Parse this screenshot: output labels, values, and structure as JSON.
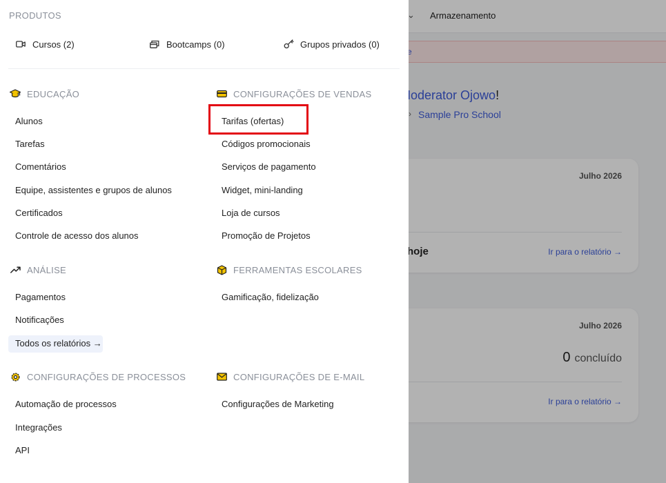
{
  "background": {
    "topbar_chevron": "⌄",
    "storage_label": "Armazenamento",
    "banner_fragment": "e",
    "greeting": "Moderator Ojowo",
    "greeting_suffix": "!",
    "breadcrumb_sep": "›",
    "school_name": "Sample Pro School",
    "card1": {
      "date": "Julho 2026",
      "today_fragment": "hoje",
      "report_link": "Ir para o relatório →"
    },
    "card2": {
      "date": "Julho 2026",
      "count": "0",
      "count_label": "concluído",
      "report_link": "Ir para o relatório →"
    }
  },
  "menu": {
    "products": {
      "title": "PRODUTOS",
      "items": [
        {
          "label": "Cursos (2)",
          "icon": "video-icon"
        },
        {
          "label": "Bootcamps (0)",
          "icon": "bootcamp-icon"
        },
        {
          "label": "Grupos privados (0)",
          "icon": "key-icon"
        }
      ]
    },
    "education": {
      "title": "EDUCAÇÃO",
      "icon": "graduation-cap-icon",
      "items": [
        "Alunos",
        "Tarefas",
        "Comentários",
        "Equipe, assistentes e grupos de alunos",
        "Certificados",
        "Controle de acesso dos alunos"
      ]
    },
    "sales": {
      "title": "CONFIGURAÇÕES DE VENDAS",
      "icon": "credit-card-icon",
      "items": [
        "Tarifas (ofertas)",
        "Códigos promocionais",
        "Serviços de pagamento",
        "Widget, mini-landing",
        "Loja de cursos",
        "Promoção de Projetos"
      ]
    },
    "analysis": {
      "title": "ANÁLISE",
      "icon": "trend-up-icon",
      "items": [
        "Pagamentos",
        "Notificações",
        "Todos os relatórios →"
      ]
    },
    "school_tools": {
      "title": "FERRAMENTAS ESCOLARES",
      "icon": "cube-icon",
      "items": [
        "Gamificação, fidelização"
      ]
    },
    "processes": {
      "title": "CONFIGURAÇÕES DE PROCESSOS",
      "icon": "gear-icon",
      "items": [
        "Automação de processos",
        "Integrações",
        "API"
      ]
    },
    "email": {
      "title": "CONFIGURAÇÕES DE E-MAIL",
      "icon": "envelope-icon",
      "items": [
        "Configurações de Marketing"
      ]
    }
  },
  "colors": {
    "accent_link": "#3d5bd9",
    "highlight_border": "#e30613",
    "section_head": "#8a8f99",
    "icon_yellow": "#f2c200"
  }
}
